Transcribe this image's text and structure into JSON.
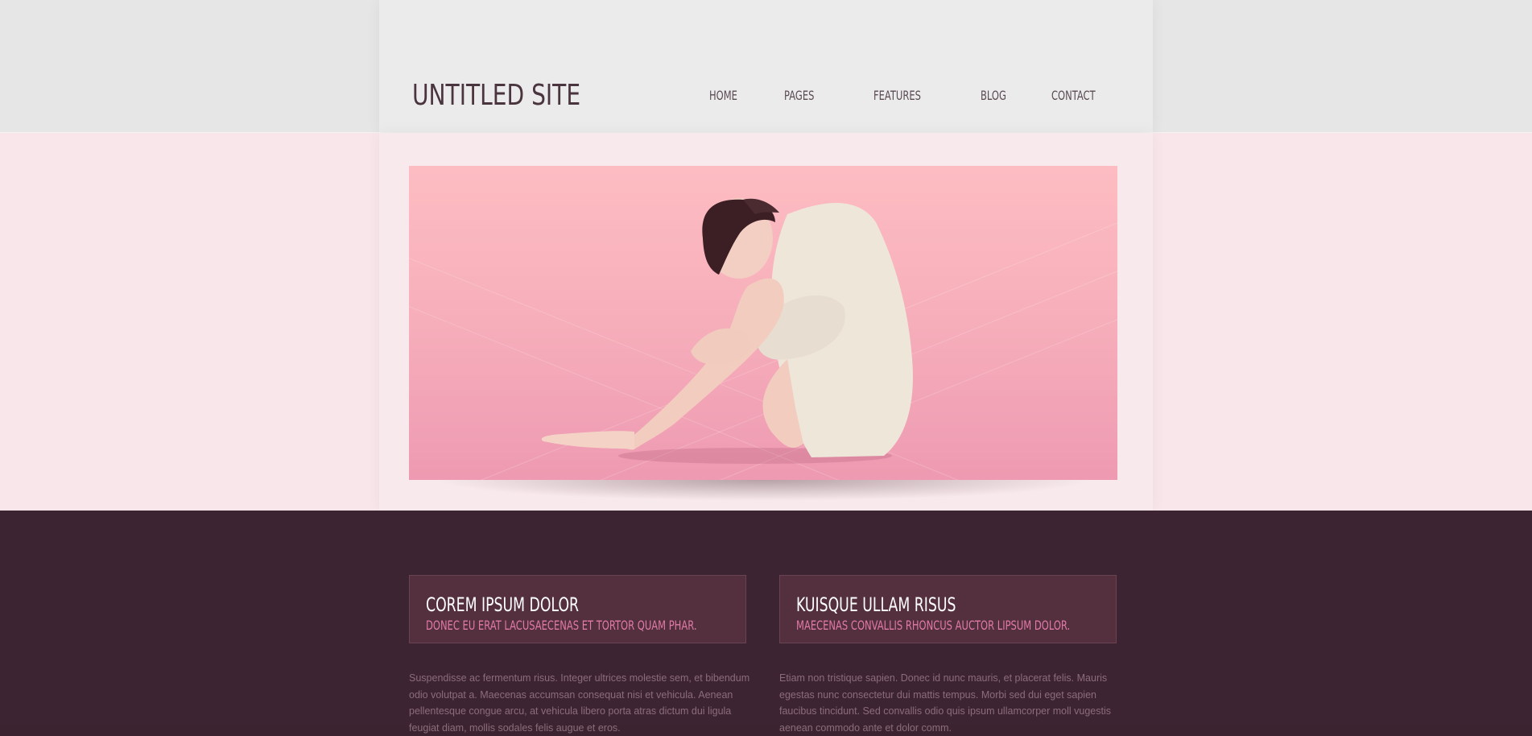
{
  "header": {
    "site_title": "UNTITLED SITE",
    "nav": [
      "HOME",
      "PAGES",
      "FEATURES",
      "BLOG",
      "CONTACT"
    ]
  },
  "hero": {
    "image_alt": "woman-sitting-on-pink-floor"
  },
  "features": [
    {
      "title": "COREM IPSUM DOLOR",
      "subtitle": "DONEC EU ERAT LACUSAECENAS ET TORTOR QUAM PHAR.",
      "text": "Suspendisse ac fermentum risus. Integer ultrices molestie sem, et bibendum odio volutpat a. Maecenas accumsan consequat nisi et vehicula. Aenean pellentesque congue arcu, at vehicula libero porta atras dictum dui ligula feugiat diam, mollis sodales felis augue et eros."
    },
    {
      "title": "KUISQUE ULLAM RISUS",
      "subtitle": "MAECENAS CONVALLIS RHONCUS AUCTOR LIPSUM DOLOR.",
      "text": "Etiam non tristique sapien. Donec id nunc mauris, et placerat felis. Mauris egestas nunc consectetur dui mattis tempus. Morbi sed dui eget sapien faucibus tincidunt. Sed convallis odio quis ipsum ullamcorper moll vugestis aenean commodo ante et dolor comm."
    }
  ],
  "colors": {
    "header_bg": "#ebebeb",
    "hero_bg": "#f9e6ea",
    "content_bg": "#3d2432",
    "accent_pink": "#e07aa6"
  }
}
